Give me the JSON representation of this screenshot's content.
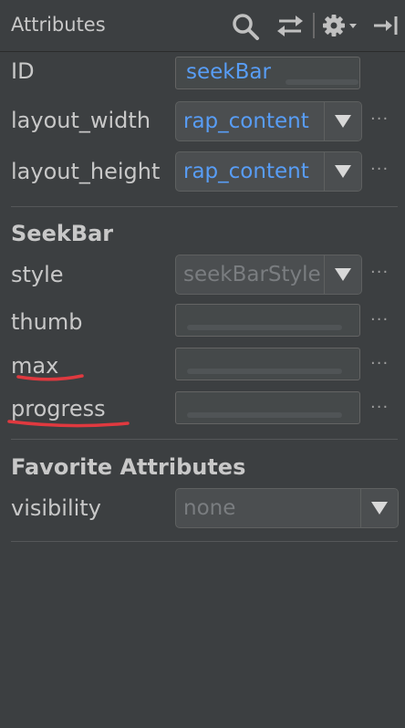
{
  "header": {
    "title": "Attributes",
    "icons": [
      "search-icon",
      "swap-icon",
      "gear-icon",
      "collapse-icon"
    ]
  },
  "attributes": {
    "id": {
      "label": "ID",
      "value": "seekBar"
    },
    "layout_width": {
      "label": "layout_width",
      "value": "rap_content"
    },
    "layout_height": {
      "label": "layout_height",
      "value": "rap_content"
    }
  },
  "seekbar": {
    "title": "SeekBar",
    "style": {
      "label": "style",
      "value": "seekBarStyle"
    },
    "thumb": {
      "label": "thumb",
      "value": ""
    },
    "max": {
      "label": "max",
      "value": ""
    },
    "progress": {
      "label": "progress",
      "value": ""
    }
  },
  "favorites": {
    "title": "Favorite Attributes",
    "visibility": {
      "label": "visibility",
      "value": "none"
    }
  },
  "more_label": "···",
  "colors": {
    "background": "#3c3f41",
    "value_text": "#589df6",
    "annotation": "#e0393f"
  }
}
